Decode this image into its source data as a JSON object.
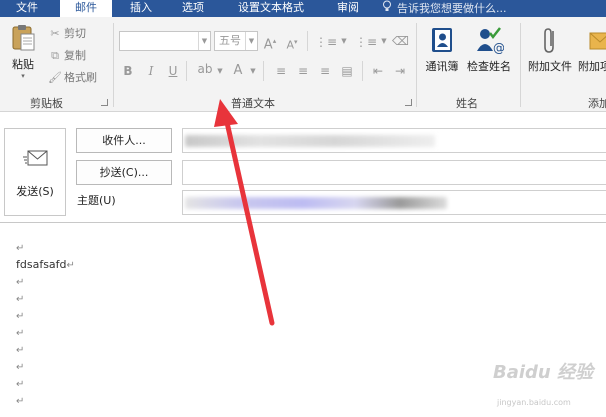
{
  "tabs": [
    "文件",
    "邮件",
    "插入",
    "选项",
    "设置文本格式",
    "审阅"
  ],
  "active_tab": "邮件",
  "tell_me": "告诉我您想要做什么...",
  "clipboard": {
    "paste": "粘贴",
    "cut": "剪切",
    "copy": "复制",
    "format_painter": "格式刷",
    "label": "剪贴板"
  },
  "basic_text": {
    "font_size": "五号",
    "label": "普通文本"
  },
  "names": {
    "address_book": "通讯簿",
    "check_names": "检查姓名",
    "label": "姓名"
  },
  "include": {
    "attach_file": "附加文件",
    "attach_item": "附加项",
    "label": "添加"
  },
  "compose": {
    "send": "发送(S)",
    "to_button": "收件人...",
    "cc_button": "抄送(C)...",
    "subject_label": "主题(U)"
  },
  "body": {
    "para_mark": "↵",
    "first_line": "fdsafsafd"
  },
  "watermark": {
    "brand": "Baidu 经验",
    "site": "jingyan.baidu.com"
  },
  "colors": {
    "accent": "#2b579a",
    "arrow": "#e8343b"
  }
}
